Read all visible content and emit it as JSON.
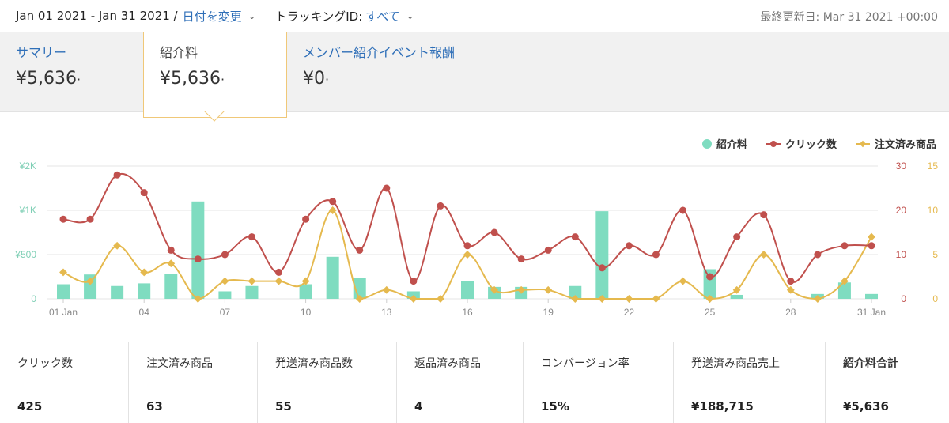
{
  "header": {
    "date_range": "Jan 01 2021 - Jan 31 2021 /",
    "change_date": "日付を変更",
    "tracking_label": "トラッキングID:",
    "tracking_value": "すべて",
    "last_updated": "最終更新日: Mar 31 2021 +00:00"
  },
  "tabs": [
    {
      "title": "サマリー",
      "value": "¥5,636"
    },
    {
      "title": "紹介料",
      "value": "¥5,636"
    },
    {
      "title": "メンバー紹介イベント報酬",
      "value": "¥0"
    }
  ],
  "legend": {
    "fee": "紹介料",
    "clicks": "クリック数",
    "ordered": "注文済み商品"
  },
  "colors": {
    "fee": "#7fdcc0",
    "clicks": "#c0504d",
    "ordered": "#e5b94e",
    "link": "#2f6fb8"
  },
  "chart_data": {
    "type": "bar",
    "x": [
      "01 Jan",
      "02",
      "03",
      "04",
      "05",
      "06",
      "07",
      "08",
      "09",
      "10",
      "11",
      "12",
      "13",
      "14",
      "15",
      "16",
      "17",
      "18",
      "19",
      "20",
      "21",
      "22",
      "23",
      "24",
      "25",
      "26",
      "27",
      "28",
      "29",
      "30",
      "31 Jan"
    ],
    "x_tick_labels": [
      "01 Jan",
      "04",
      "07",
      "10",
      "13",
      "16",
      "19",
      "22",
      "25",
      "28",
      "31 Jan"
    ],
    "y_left_ticks": [
      "0",
      "¥500",
      "¥1K",
      "¥2K"
    ],
    "y_clicks_ticks": [
      "0",
      "10",
      "20",
      "30"
    ],
    "y_ordered_ticks": [
      "0",
      "5",
      "10",
      "15"
    ],
    "series": [
      {
        "name": "紹介料",
        "type": "bar",
        "values": [
          165,
          275,
          145,
          175,
          280,
          1200,
          85,
          145,
          0,
          165,
          475,
          235,
          0,
          85,
          0,
          205,
          135,
          135,
          0,
          145,
          990,
          0,
          0,
          0,
          335,
          45,
          0,
          0,
          55,
          185,
          55
        ]
      },
      {
        "name": "クリック数",
        "type": "line",
        "values": [
          18,
          18,
          28,
          24,
          11,
          9,
          10,
          14,
          6,
          18,
          22,
          11,
          25,
          4,
          21,
          12,
          15,
          9,
          11,
          14,
          7,
          12,
          10,
          20,
          5,
          14,
          19,
          4,
          10,
          12,
          12
        ]
      },
      {
        "name": "注文済み商品",
        "type": "line",
        "values": [
          3,
          2,
          6,
          3,
          4,
          0,
          2,
          2,
          2,
          2,
          10,
          0,
          1,
          0,
          0,
          5,
          1,
          1,
          1,
          0,
          0,
          0,
          0,
          2,
          0,
          1,
          5,
          1,
          0,
          2,
          7
        ]
      }
    ]
  },
  "metrics": [
    {
      "label": "クリック数",
      "value": "425"
    },
    {
      "label": "注文済み商品",
      "value": "63"
    },
    {
      "label": "発送済み商品数",
      "value": "55"
    },
    {
      "label": "返品済み商品",
      "value": "4"
    },
    {
      "label": "コンバージョン率",
      "value": "15%"
    },
    {
      "label": "発送済み商品売上",
      "value": "¥188,715"
    },
    {
      "label": "紹介料合計",
      "value": "¥5,636"
    }
  ]
}
